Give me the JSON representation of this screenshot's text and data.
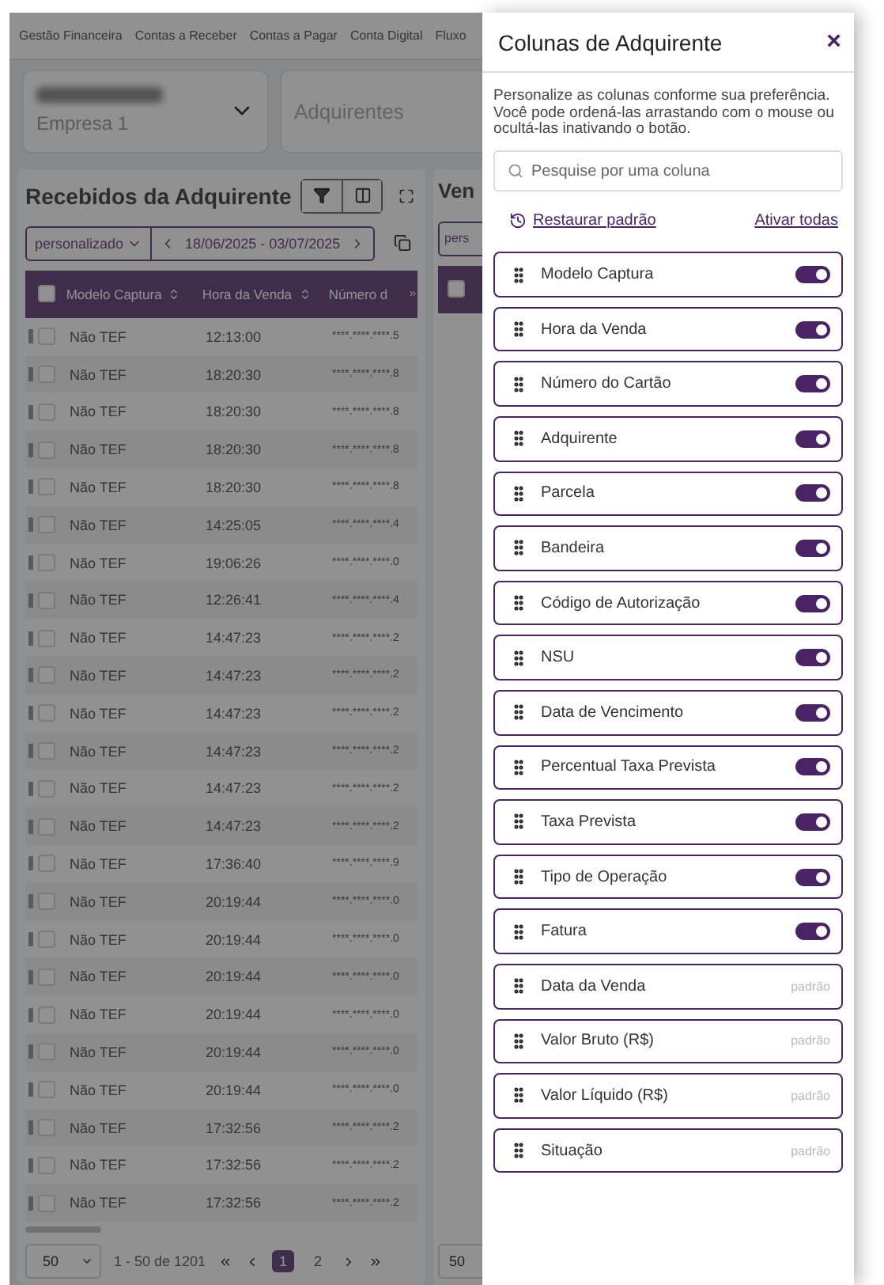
{
  "nav": [
    {
      "label": "Gestão Financeira"
    },
    {
      "label": "Contas a Receber"
    },
    {
      "label": "Contas a Pagar"
    },
    {
      "label": "Conta Digital"
    },
    {
      "label": "Fluxo"
    }
  ],
  "filters": {
    "company": {
      "subtitle": "Empresa 1"
    },
    "acquirer": {
      "placeholder": "Adquirentes"
    }
  },
  "table_panel": {
    "title": "Recebidos da Adquirente",
    "period": "personalizado",
    "date_range": "18/06/2025 - 03/07/2025",
    "columns": [
      {
        "label": "Modelo Captura"
      },
      {
        "label": "Hora da Venda"
      },
      {
        "label": "Número d"
      }
    ],
    "header_checked": false,
    "rows": [
      {
        "checked": false,
        "capture": "Não TEF",
        "time": "12:13:00",
        "card": "****.****.****.5"
      },
      {
        "checked": false,
        "capture": "Não TEF",
        "time": "18:20:30",
        "card": "****.****.****.8"
      },
      {
        "checked": false,
        "capture": "Não TEF",
        "time": "18:20:30",
        "card": "****.****.****.8"
      },
      {
        "checked": false,
        "capture": "Não TEF",
        "time": "18:20:30",
        "card": "****.****.****.8"
      },
      {
        "checked": false,
        "capture": "Não TEF",
        "time": "18:20:30",
        "card": "****.****.****.8"
      },
      {
        "checked": false,
        "capture": "Não TEF",
        "time": "14:25:05",
        "card": "****.****.****.4"
      },
      {
        "checked": false,
        "capture": "Não TEF",
        "time": "19:06:26",
        "card": "****.****.****.0"
      },
      {
        "checked": false,
        "capture": "Não TEF",
        "time": "12:26:41",
        "card": "****.****.****.4"
      },
      {
        "checked": false,
        "capture": "Não TEF",
        "time": "14:47:23",
        "card": "****.****.****.2"
      },
      {
        "checked": false,
        "capture": "Não TEF",
        "time": "14:47:23",
        "card": "****.****.****.2"
      },
      {
        "checked": false,
        "capture": "Não TEF",
        "time": "14:47:23",
        "card": "****.****.****.2"
      },
      {
        "checked": false,
        "capture": "Não TEF",
        "time": "14:47:23",
        "card": "****.****.****.2"
      },
      {
        "checked": false,
        "capture": "Não TEF",
        "time": "14:47:23",
        "card": "****.****.****.2"
      },
      {
        "checked": false,
        "capture": "Não TEF",
        "time": "14:47:23",
        "card": "****.****.****.2"
      },
      {
        "checked": false,
        "capture": "Não TEF",
        "time": "17:36:40",
        "card": "****.****.****.9"
      },
      {
        "checked": false,
        "capture": "Não TEF",
        "time": "20:19:44",
        "card": "****.****.****.0"
      },
      {
        "checked": false,
        "capture": "Não TEF",
        "time": "20:19:44",
        "card": "****.****.****.0"
      },
      {
        "checked": false,
        "capture": "Não TEF",
        "time": "20:19:44",
        "card": "****.****.****.0"
      },
      {
        "checked": false,
        "capture": "Não TEF",
        "time": "20:19:44",
        "card": "****.****.****.0"
      },
      {
        "checked": false,
        "capture": "Não TEF",
        "time": "20:19:44",
        "card": "****.****.****.0"
      },
      {
        "checked": false,
        "capture": "Não TEF",
        "time": "20:19:44",
        "card": "****.****.****.0"
      },
      {
        "checked": false,
        "capture": "Não TEF",
        "time": "17:32:56",
        "card": "****.****.****.2"
      },
      {
        "checked": false,
        "capture": "Não TEF",
        "time": "17:32:56",
        "card": "****.****.****.2"
      },
      {
        "checked": false,
        "capture": "Não TEF",
        "time": "17:32:56",
        "card": "****.****.****.2"
      }
    ],
    "page_size": "50",
    "range": "1 - 50 de 1201",
    "pages": [
      {
        "label": "1",
        "selected": true
      },
      {
        "label": "2",
        "selected": false
      }
    ]
  },
  "second_panel": {
    "title": "Ven",
    "period": "pers",
    "header_checked": false,
    "page_size": "50"
  },
  "drawer": {
    "title": "Colunas de Adquirente",
    "close": "×",
    "description": "Personalize as colunas conforme sua preferência. Você pode ordená-las arrastando com o mouse ou ocultá-las inativando o botão.",
    "search": {
      "placeholder": "Pesquise por uma coluna"
    },
    "restore": "Restaurar padrão",
    "enable_all": "Ativar todas",
    "columns": [
      {
        "label": "Modelo Captura",
        "kind": "toggle",
        "on": true
      },
      {
        "label": "Hora da Venda",
        "kind": "toggle",
        "on": true
      },
      {
        "label": "Número do Cartão",
        "kind": "toggle",
        "on": true
      },
      {
        "label": "Adquirente",
        "kind": "toggle",
        "on": true
      },
      {
        "label": "Parcela",
        "kind": "toggle",
        "on": true
      },
      {
        "label": "Bandeira",
        "kind": "toggle",
        "on": true
      },
      {
        "label": "Código de Autorização",
        "kind": "toggle",
        "on": true
      },
      {
        "label": "NSU",
        "kind": "toggle",
        "on": true
      },
      {
        "label": "Data de Vencimento",
        "kind": "toggle",
        "on": true
      },
      {
        "label": "Percentual Taxa Prevista",
        "kind": "toggle",
        "on": true
      },
      {
        "label": "Taxa Prevista",
        "kind": "toggle",
        "on": true
      },
      {
        "label": "Tipo de Operação",
        "kind": "toggle",
        "on": true
      },
      {
        "label": "Fatura",
        "kind": "toggle",
        "on": true
      },
      {
        "label": "Data da Venda",
        "kind": "fixed",
        "badge": "padrão"
      },
      {
        "label": "Valor Bruto (R$)",
        "kind": "fixed",
        "badge": "padrão"
      },
      {
        "label": "Valor Líquido (R$)",
        "kind": "fixed",
        "badge": "padrão"
      },
      {
        "label": "Situação",
        "kind": "fixed",
        "badge": "padrão"
      }
    ]
  }
}
